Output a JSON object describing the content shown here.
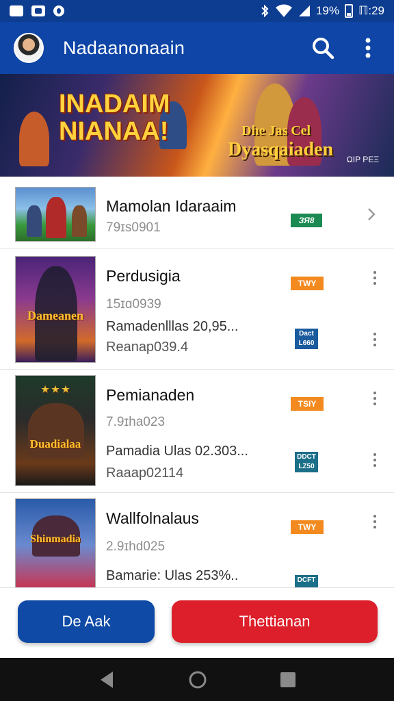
{
  "status_bar": {
    "battery": "19%",
    "time": "ℿ:29"
  },
  "app_bar": {
    "title": "Nadaanonaain",
    "search_icon": "search-icon",
    "menu_icon": "more-vert-icon"
  },
  "banner": {
    "headline_line1": "INADAIM",
    "headline_line2": "NIANAA!",
    "game_logo_line1": "Dhe Jas Cel",
    "game_logo_line2": "Dyasqaiaden",
    "corner_text": "ΩΙΡ ΡΕΞ"
  },
  "list": {
    "items": [
      {
        "title": "Mamolan Idaraaim",
        "subtitle": "79ɪs0901",
        "badge": "ЗЯ8"
      },
      {
        "title": "Perdusigia",
        "subtitle": "15ɪɑ0939",
        "detail1": "Ramadenlllas 20,95...",
        "detail2": "Reanap039.4",
        "badge": "TWY",
        "badge2": "Dact L660",
        "thumb_logo": "Dameanen"
      },
      {
        "title": "Pemianaden",
        "subtitle": "7.9ɪha023",
        "detail1": "Pamadia Ulas 02.303...",
        "detail2": "Raaap02114",
        "badge": "TSIY",
        "badge2": "DDCT LZ50",
        "thumb_logo": "Duadialaa"
      },
      {
        "title": "Wallfolnalaus",
        "subtitle": "2.9ɪhd025",
        "detail1": "Bamarie: Ulas 253%..",
        "badge": "TWY",
        "badge2": "DCFT",
        "thumb_logo": "Shinmadia"
      }
    ]
  },
  "actions": {
    "primary_label": "De Aak",
    "danger_label": "Thettianan"
  },
  "colors": {
    "app_bar": "#0e45a6",
    "primary_button": "#0e4aa6",
    "danger_button": "#dc1f2a",
    "badge_green": "#1b8a52",
    "badge_orange": "#f38a1f",
    "badge_blue": "#1a5b9d"
  }
}
